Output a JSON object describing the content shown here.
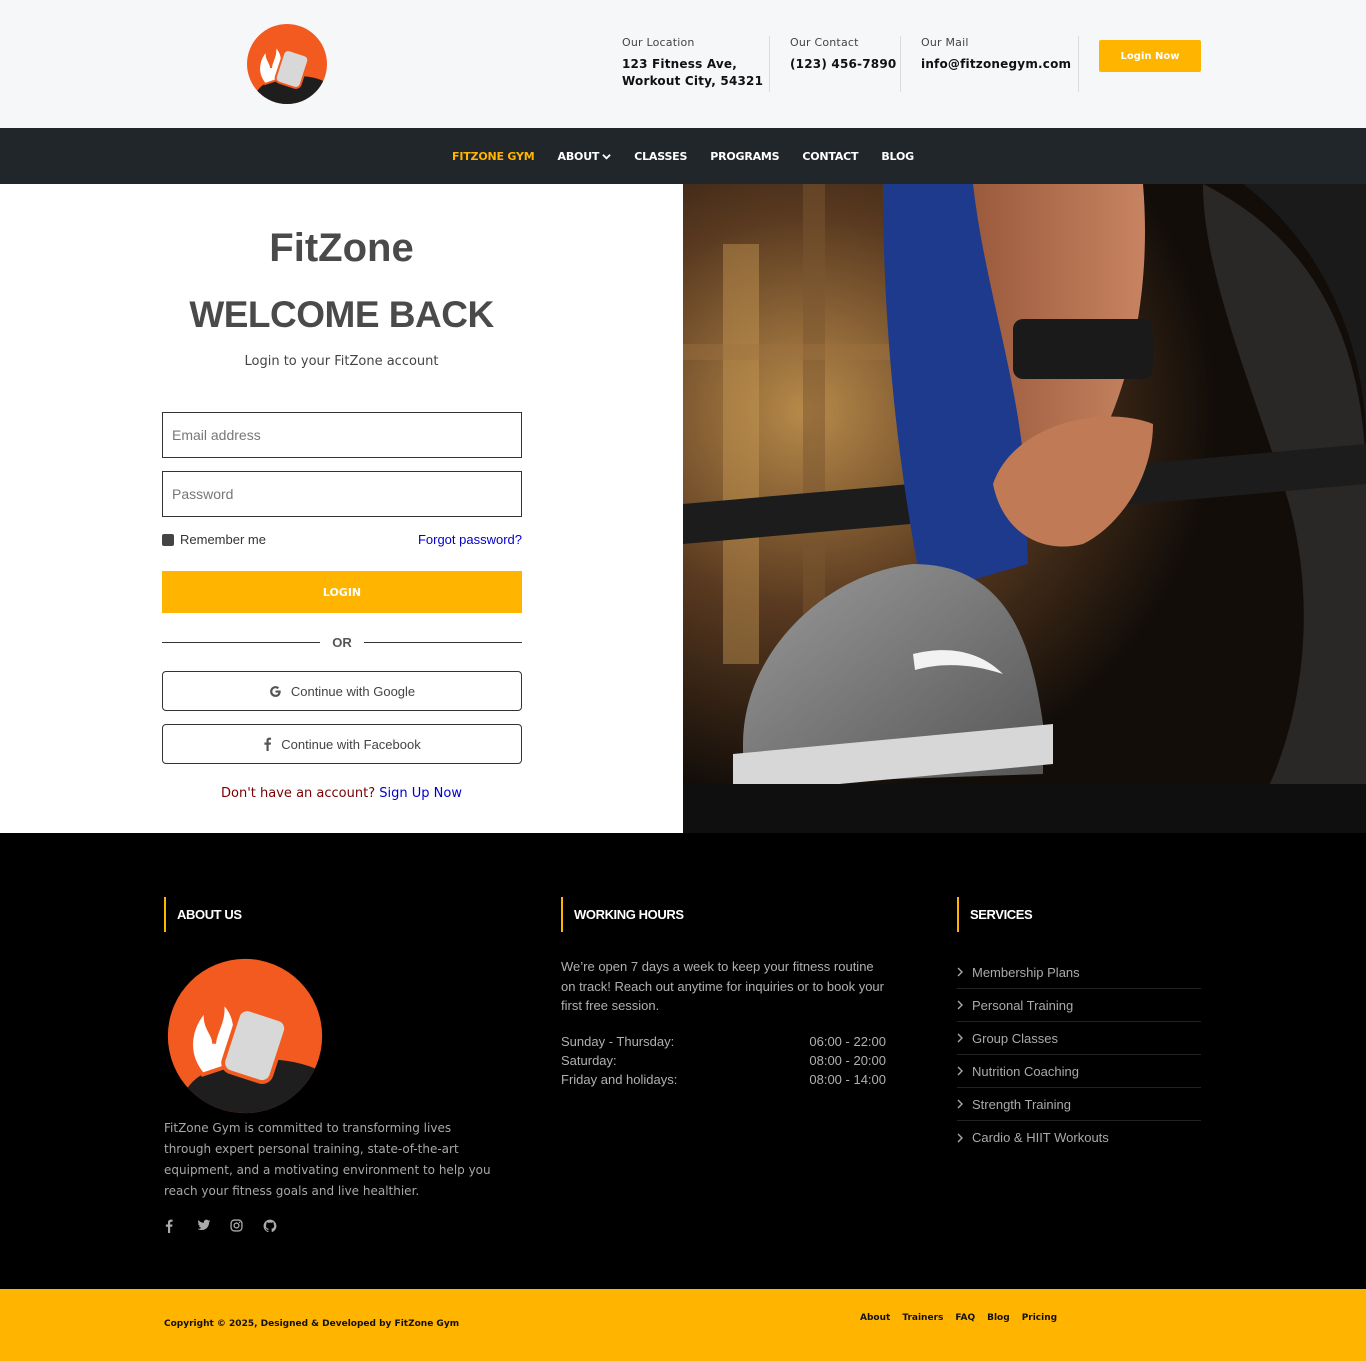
{
  "header": {
    "location_label": "Our Location",
    "location_line1": "123 Fitness Ave,",
    "location_line2": "Workout City, 54321",
    "contact_label": "Our Contact",
    "contact_value": "(123) 456-7890",
    "mail_label": "Our Mail",
    "mail_value": "info@fitzonegym.com",
    "login_now": "Login Now"
  },
  "nav": {
    "items": [
      "FITZONE GYM",
      "ABOUT",
      "CLASSES",
      "PROGRAMS",
      "CONTACT",
      "BLOG"
    ],
    "active": "FITZONE GYM"
  },
  "login": {
    "brand": "FitZone",
    "heading": "WELCOME BACK",
    "subtitle": "Login to your FitZone account",
    "email_placeholder": "Email address",
    "password_placeholder": "Password",
    "remember": "Remember me",
    "forgot": "Forgot password?",
    "button": "LOGIN",
    "or": "OR",
    "google": "Continue with Google",
    "facebook": "Continue with Facebook",
    "signup_question": "Don't have an account?",
    "signup_link": "Sign Up Now"
  },
  "footer": {
    "about_title": "ABOUT US",
    "about_text": "FitZone Gym is committed to transforming lives through expert personal training, state-of-the-art equipment, and a motivating environment to help you reach your fitness goals and live healthier.",
    "hours_title": "WORKING HOURS",
    "hours_intro": "We’re open 7 days a week to keep your fitness routine on track! Reach out anytime for inquiries or to book your first free session.",
    "hours": [
      {
        "day": "Sunday - Thursday:",
        "time": "06:00 - 22:00"
      },
      {
        "day": "Saturday:",
        "time": "08:00 - 20:00"
      },
      {
        "day": "Friday and holidays:",
        "time": "08:00 - 14:00"
      }
    ],
    "services_title": "SERVICES",
    "services": [
      "Membership Plans",
      "Personal Training",
      "Group Classes",
      "Nutrition Coaching",
      "Strength Training",
      "Cardio & HIIT Workouts"
    ],
    "social_icons": [
      "facebook-icon",
      "twitter-icon",
      "instagram-icon",
      "github-icon"
    ]
  },
  "bottom": {
    "copyright": "Copyright © 2025, Designed & Developed by FitZone Gym",
    "links": [
      "About",
      "Trainers",
      "FAQ",
      "Blog",
      "Pricing"
    ]
  },
  "colors": {
    "accent": "#ffb400",
    "nav_bg": "#21262b",
    "footer_bg": "#000000",
    "logo_orange": "#f25a1f"
  }
}
